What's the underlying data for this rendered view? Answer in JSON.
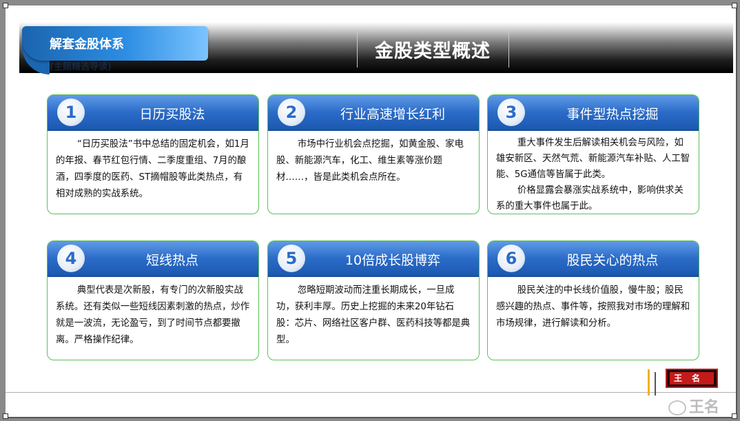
{
  "tab": {
    "label": "解套金股体系",
    "ghost_text": "(主题精选导读)"
  },
  "header": {
    "title": "金股类型概述"
  },
  "cards": [
    {
      "number": "1",
      "title": "日历买股法",
      "paragraphs": [
        "“日历买股法”书中总结的固定机会，如1月的年报、春节红包行情、二季度重组、7月的酿酒，四季度的医药、ST摘帽股等此类热点，有相对成熟的实战系统。"
      ]
    },
    {
      "number": "2",
      "title": "行业高速增长红利",
      "paragraphs": [
        "市场中行业机会点挖掘，如黄金股、家电股、新能源汽车，化工、维生素等涨价题材……，皆是此类机会点所在。"
      ]
    },
    {
      "number": "3",
      "title": "事件型热点挖掘",
      "paragraphs": [
        "重大事件发生后解读相关机会与风险，如雄安新区、天然气荒、新能源汽车补贴、人工智能、5G通信等皆属于此类。",
        "价格显露会暴涨实战系统中，影响供求关系的重大事件也属于此。"
      ]
    },
    {
      "number": "4",
      "title": "短线热点",
      "paragraphs": [
        "典型代表是次新股，有专门的次新股实战系统。还有类似一些短线因素刺激的热点，炒作就是一波流，无论盈亏，到了时间节点都要撤离。严格操作纪律。"
      ]
    },
    {
      "number": "5",
      "title": "10倍成长股博弈",
      "paragraphs": [
        "忽略短期波动而注重长期成长，一旦成功，获利丰厚。历史上挖掘的未来20年钻石股：芯片、网络社区客户群、医药科技等都是典型。"
      ]
    },
    {
      "number": "6",
      "title": "股民关心的热点",
      "paragraphs": [
        "股民关注的中长线价值股，慢牛股；股民感兴趣的热点、事件等，按照我对市场的理解和市场规律，进行解读和分析。"
      ]
    }
  ],
  "seal": {
    "text": "王名"
  },
  "watermark": {
    "text": "王名"
  },
  "icons": {
    "watermark": "weibo-icon"
  }
}
